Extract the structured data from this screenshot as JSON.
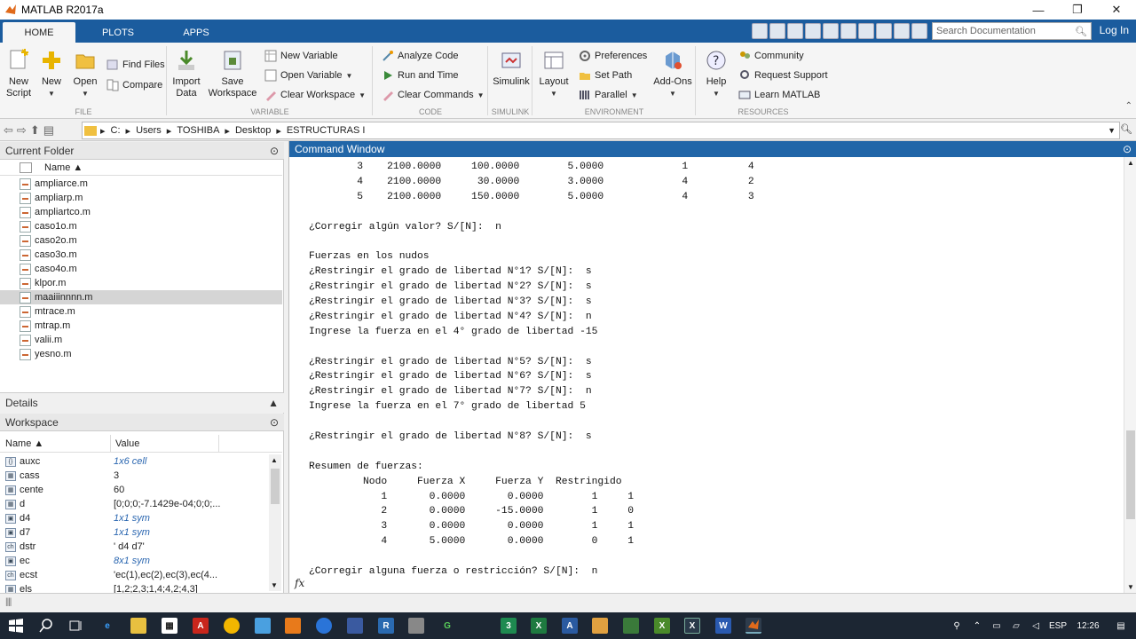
{
  "window": {
    "title": "MATLAB R2017a",
    "min": "—",
    "restore": "❐",
    "close": "✕"
  },
  "tabs": [
    {
      "label": "HOME"
    },
    {
      "label": "PLOTS"
    },
    {
      "label": "APPS"
    }
  ],
  "search": {
    "placeholder": "Search Documentation"
  },
  "login": "Log In",
  "ribbon": {
    "file": {
      "group": "FILE",
      "new_script": "New\nScript",
      "new": "New",
      "open": "Open",
      "find_files": "Find Files",
      "compare": "Compare"
    },
    "variable": {
      "group": "VARIABLE",
      "import": "Import\nData",
      "save_ws": "Save\nWorkspace",
      "new_var": "New Variable",
      "open_var": "Open Variable",
      "clear_ws": "Clear Workspace"
    },
    "code": {
      "group": "CODE",
      "analyze": "Analyze Code",
      "run_time": "Run and Time",
      "clear_cmds": "Clear Commands"
    },
    "simulink": {
      "group": "SIMULINK",
      "label": "Simulink"
    },
    "environment": {
      "group": "ENVIRONMENT",
      "layout": "Layout",
      "preferences": "Preferences",
      "set_path": "Set Path",
      "parallel": "Parallel",
      "addons": "Add-Ons"
    },
    "resources": {
      "group": "RESOURCES",
      "help": "Help",
      "community": "Community",
      "request_support": "Request Support",
      "learn": "Learn MATLAB"
    }
  },
  "path": [
    "C:",
    "Users",
    "TOSHIBA",
    "Desktop",
    "ESTRUCTURAS I"
  ],
  "current_folder": {
    "title": "Current Folder",
    "col_name": "Name ▲",
    "files": [
      "ampliarce.m",
      "ampliarp.m",
      "ampliartco.m",
      "caso1o.m",
      "caso2o.m",
      "caso3o.m",
      "caso4o.m",
      "klpor.m",
      "maaiiinnnn.m",
      "mtrace.m",
      "mtrap.m",
      "valii.m",
      "yesno.m"
    ],
    "selected": "maaiiinnnn.m"
  },
  "details": {
    "title": "Details"
  },
  "workspace": {
    "title": "Workspace",
    "col_name": "Name ▲",
    "col_value": "Value",
    "vars": [
      {
        "icon": "{}",
        "name": "auxc",
        "value": "1x6 cell",
        "italic": true
      },
      {
        "icon": "▦",
        "name": "cass",
        "value": "3",
        "italic": false
      },
      {
        "icon": "▦",
        "name": "cente",
        "value": "60",
        "italic": false
      },
      {
        "icon": "▦",
        "name": "d",
        "value": "[0;0;0;-7.1429e-04;0;0;...",
        "italic": false
      },
      {
        "icon": "▣",
        "name": "d4",
        "value": "1x1 sym",
        "italic": true
      },
      {
        "icon": "▣",
        "name": "d7",
        "value": "1x1 sym",
        "italic": true
      },
      {
        "icon": "ch",
        "name": "dstr",
        "value": "' d4 d7'",
        "italic": false
      },
      {
        "icon": "▣",
        "name": "ec",
        "value": "8x1 sym",
        "italic": true
      },
      {
        "icon": "ch",
        "name": "ecst",
        "value": "'ec(1),ec(2),ec(3),ec(4...",
        "italic": false
      },
      {
        "icon": "▦",
        "name": "els",
        "value": "[1,2;2,3;1,4;4,2;4,3]",
        "italic": false
      }
    ]
  },
  "command_window": {
    "title": "Command Window",
    "lines": [
      "        3    2100.0000     100.0000        5.0000             1          4",
      "        4    2100.0000      30.0000        3.0000             4          2",
      "        5    2100.0000     150.0000        5.0000             4          3",
      "",
      "¿Corregir algún valor? S/[N]:  n",
      "",
      "Fuerzas en los nudos",
      "¿Restringir el grado de libertad N°1? S/[N]:  s",
      "¿Restringir el grado de libertad N°2? S/[N]:  s",
      "¿Restringir el grado de libertad N°3? S/[N]:  s",
      "¿Restringir el grado de libertad N°4? S/[N]:  n",
      "Ingrese la fuerza en el 4° grado de libertad -15",
      "",
      "¿Restringir el grado de libertad N°5? S/[N]:  s",
      "¿Restringir el grado de libertad N°6? S/[N]:  s",
      "¿Restringir el grado de libertad N°7? S/[N]:  n",
      "Ingrese la fuerza en el 7° grado de libertad 5",
      "",
      "¿Restringir el grado de libertad N°8? S/[N]:  s",
      "",
      "Resumen de fuerzas:",
      "         Nodo     Fuerza X     Fuerza Y  Restringido",
      "            1       0.0000       0.0000        1     1",
      "            2       0.0000     -15.0000        1     0",
      "            3       0.0000       0.0000        1     1",
      "            4       5.0000       0.0000        0     1",
      "",
      "¿Corregir alguna fuerza o restricción? S/[N]:  n"
    ],
    "fx": "fx"
  },
  "taskbar": {
    "lang": "ESP",
    "time": "12:26"
  }
}
